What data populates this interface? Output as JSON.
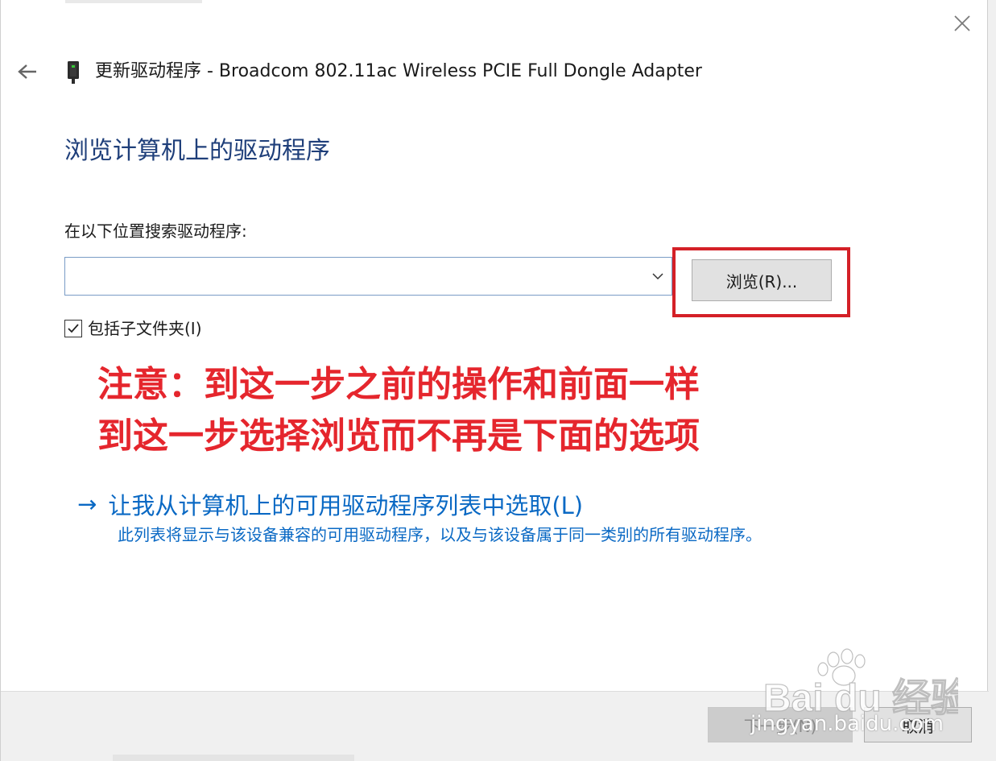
{
  "window": {
    "title": "更新驱动程序 - Broadcom 802.11ac Wireless PCIE Full Dongle Adapter",
    "close_icon": "close-icon",
    "back_icon": "arrow-left-icon",
    "device_icon": "network-adapter-icon"
  },
  "main": {
    "heading": "浏览计算机上的驱动程序",
    "location_label": "在以下位置搜索驱动程序:",
    "location_value": "",
    "browse_label": "浏览(R)...",
    "include_subfolders_label": "包括子文件夹(I)",
    "include_subfolders_checked": true
  },
  "annotation": {
    "line1": "注意：到这一步之前的操作和前面一样",
    "line2": "到这一步选择浏览而不再是下面的选项",
    "color": "#e5262d"
  },
  "pick_option": {
    "arrow": "→",
    "label": "让我从计算机上的可用驱动程序列表中选取(L)",
    "description": "此列表将显示与该设备兼容的可用驱动程序，以及与该设备属于同一类别的所有驱动程序。"
  },
  "footer": {
    "next_label": "下一步(N)",
    "cancel_label": "取消"
  },
  "watermark": {
    "text": "Bai du 经验",
    "url": "jingyan.baidu.com"
  },
  "colors": {
    "heading": "#1f3f7a",
    "link": "#0a69c4",
    "highlight_box": "#d42027"
  }
}
